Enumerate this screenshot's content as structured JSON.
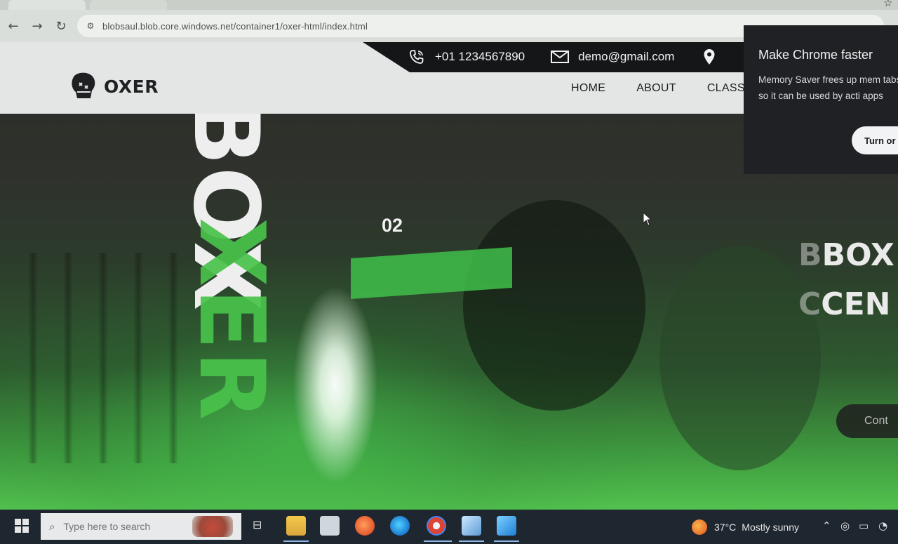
{
  "browser": {
    "url": "blobsaul.blob.core.windows.net/container1/oxer-html/index.html"
  },
  "site": {
    "brand": "OXER",
    "contact": {
      "phone": "+01 1234567890",
      "email": "demo@gmail.com"
    },
    "nav": [
      "HOME",
      "ABOUT",
      "CLASS"
    ]
  },
  "hero": {
    "vertical_word_top": "BOX",
    "vertical_word_bottom": "XER",
    "slide_number": "02",
    "heading_line1_ghost": "B",
    "heading_line1": "BOX",
    "heading_line2_ghost": "C",
    "heading_line2": "CEN",
    "button_label": "Cont"
  },
  "chrome_popup": {
    "title": "Make Chrome faster",
    "body": "Memory Saver frees up mem tabs so it can be used by acti apps",
    "button_label": "Turn or"
  },
  "taskbar": {
    "search_placeholder": "Type here to search",
    "weather_temp": "37°C",
    "weather_condition": "Mostly sunny"
  },
  "colors": {
    "accent_green": "#49c34b",
    "header_dark": "#141618",
    "chrome_popup_bg": "#202124",
    "taskbar_bg": "#1e2630"
  }
}
